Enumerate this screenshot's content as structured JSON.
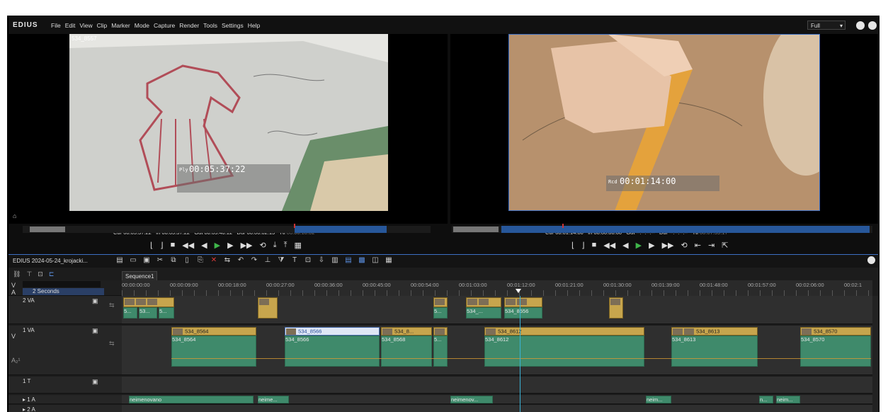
{
  "app": {
    "logo": "EDIUS",
    "menu": [
      "File",
      "Edit",
      "View",
      "Clip",
      "Marker",
      "Mode",
      "Capture",
      "Render",
      "Tools",
      "Settings",
      "Help"
    ],
    "view_mode": "Full"
  },
  "player": {
    "clip_name": "534_8557",
    "tc_label": "Ply",
    "tc_value": "00:05:37:22",
    "cur": "00:05:37:22",
    "in": "00:05:37:22",
    "out": "00:05:40:12",
    "dur": "00:00:02:15",
    "ttl": "00:00:10:02"
  },
  "recorder": {
    "tc_label": "Rcd",
    "tc_value": "00:01:14:00",
    "cur": "00:01:14:00",
    "in": "00:00:00:00",
    "out": "--:--:--:--",
    "dur": "--:--:--:--",
    "ttl": "00:07:39:17"
  },
  "labels": {
    "cur": "Cur",
    "in": "In",
    "out": "Out",
    "dur": "Dur",
    "ttl": "Ttl"
  },
  "timeline": {
    "logo": "EDIUS",
    "project": "2024-05-24_krojacki...",
    "sequence_tab": "Sequence1",
    "scale": "2 Seconds",
    "ruler": [
      "00:00:00:00",
      "00:00:09:00",
      "00:00:18:00",
      "00:00:27:00",
      "00:00:36:00",
      "00:00:45:00",
      "00:00:54:00",
      "00:01:03:00",
      "00:01:12:00",
      "00:01:21:00",
      "00:01:30:00",
      "00:01:39:00",
      "00:01:48:00",
      "00:01:57:00",
      "00:02:06:00",
      "00:02:1"
    ],
    "tracks": {
      "va2": "2 VA",
      "va1": "1 VA",
      "t1": "1 T",
      "a1": "▸ 1 A",
      "a2": "▸ 2 A",
      "side_v": "V",
      "side_a": "A"
    },
    "va2_clips": [
      "5...",
      "53...",
      "5...",
      "5...",
      "534_...",
      "534_8556"
    ],
    "va1_clips": [
      "534_8564",
      "534_8566",
      "534_8...",
      "534_8612",
      "534_8613",
      "534_8570"
    ],
    "va1_audio": [
      "534_8564",
      "534_8566",
      "534_8568",
      "5...",
      "534_8612",
      "534_8613",
      "534_8570"
    ],
    "audio_clips": [
      "neimenovano",
      "neime...",
      "neimenov...",
      "neim...",
      "n...",
      "neim..."
    ]
  },
  "colors": {
    "accent": "#3c6fc4",
    "video_clip": "#c7a54d",
    "audio_clip": "#3f8a6b",
    "play": "#3fb54a"
  }
}
